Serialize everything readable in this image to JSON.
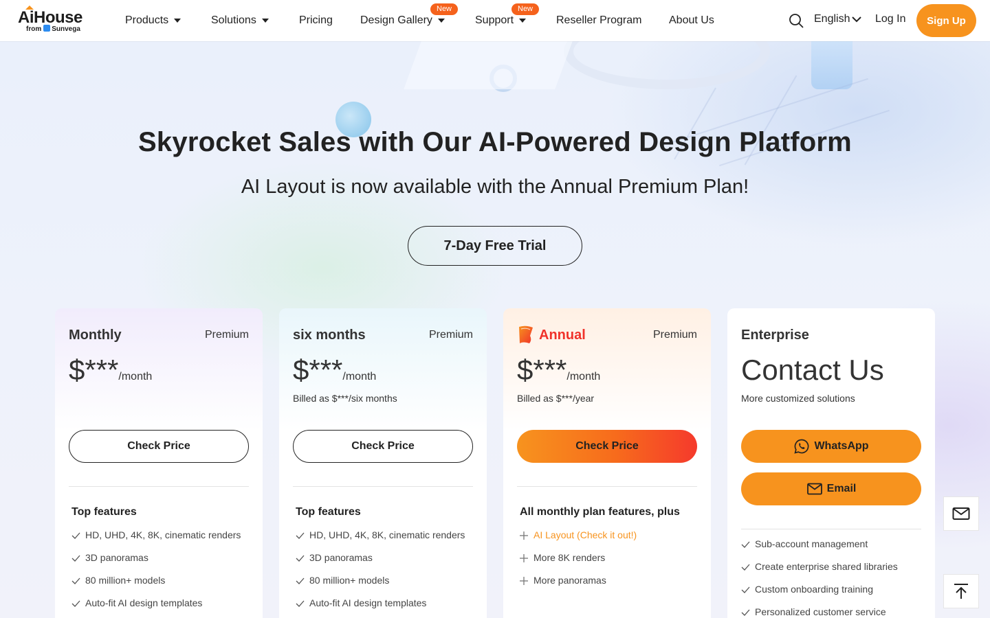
{
  "brand": {
    "logo_main": "AiHouse",
    "logo_sub_prefix": "from",
    "logo_sub_brand": "Sunvega"
  },
  "nav": {
    "products": "Products",
    "solutions": "Solutions",
    "pricing": "Pricing",
    "design_gallery": "Design Gallery",
    "support": "Support",
    "reseller": "Reseller Program",
    "about": "About Us",
    "new_badge": "New"
  },
  "header": {
    "language": "English",
    "login": "Log In",
    "signup": "Sign Up"
  },
  "hero": {
    "title": "Skyrocket Sales with Our AI-Powered Design Platform",
    "subtitle": "AI Layout is now available with the Annual Premium Plan!",
    "trial_button": "7-Day Free Trial"
  },
  "plans": [
    {
      "name": "Monthly",
      "tier": "Premium",
      "price": "$***",
      "period": "/month",
      "billed": "",
      "button": "Check Price",
      "features_heading": "Top features",
      "features": [
        "HD, UHD, 4K, 8K, cinematic renders",
        "3D panoramas",
        "80 million+ models",
        "Auto-fit AI design templates"
      ]
    },
    {
      "name": "six months",
      "tier": "Premium",
      "price": "$***",
      "period": "/month",
      "billed": "Billed as $***/six months",
      "button": "Check Price",
      "features_heading": "Top features",
      "features": [
        "HD, UHD, 4K, 8K, cinematic renders",
        "3D panoramas",
        "80 million+ models",
        "Auto-fit AI design templates"
      ]
    },
    {
      "name": "Annual",
      "tier": "Premium",
      "price": "$***",
      "period": "/month",
      "billed": "Billed as $***/year",
      "button": "Check Price",
      "features_heading": "All monthly plan features, plus",
      "features": [
        "AI Layout (Check it out!)",
        "More 8K renders",
        "More panoramas"
      ]
    },
    {
      "name": "Enterprise",
      "title": "Contact Us",
      "billed": "More customized solutions",
      "whatsapp": "WhatsApp",
      "email": "Email",
      "features": [
        "Sub-account management",
        "Create enterprise shared libraries",
        "Custom onboarding training",
        "Personalized customer service"
      ]
    }
  ],
  "colors": {
    "accent": "#f7931e",
    "badge": "#f5621c",
    "annual_red": "#f0322a"
  },
  "icons": [
    "search-icon",
    "chevron-down-icon",
    "check-icon",
    "plus-icon",
    "whatsapp-icon",
    "mail-icon",
    "back-to-top-icon",
    "annual-flag-icon"
  ]
}
